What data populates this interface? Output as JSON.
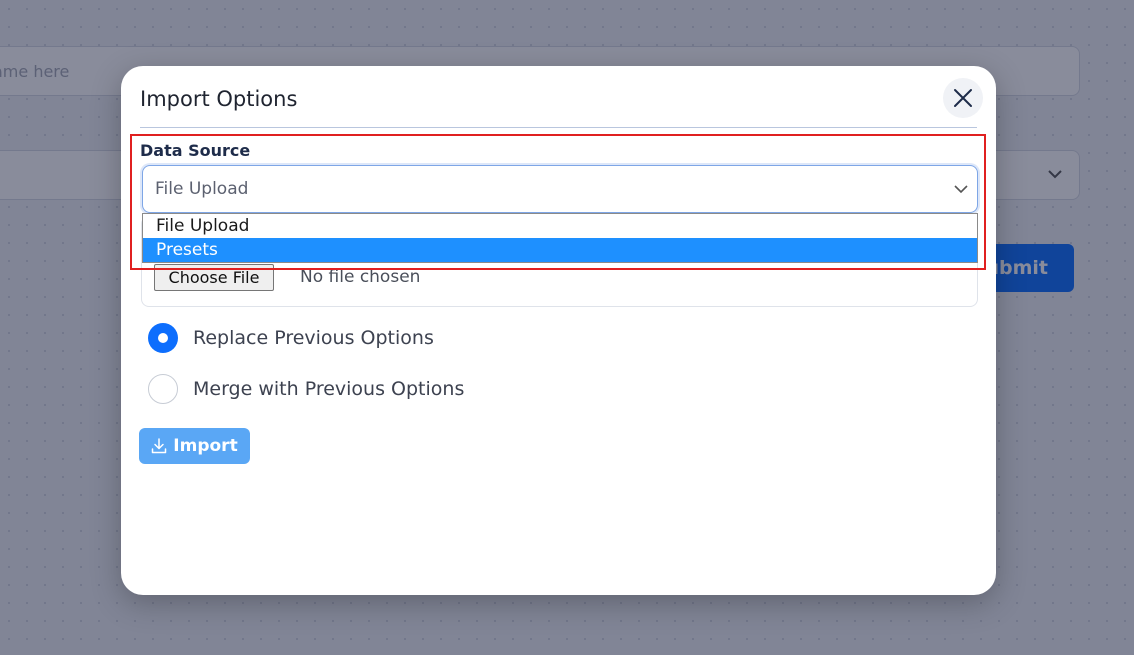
{
  "background": {
    "name_placeholder": "ame here",
    "submit_label": "Submit"
  },
  "modal": {
    "title": "Import Options",
    "data_source": {
      "label": "Data Source",
      "selected": "File Upload",
      "options": [
        "File Upload",
        "Presets"
      ],
      "highlighted_option": "Presets"
    },
    "file_input": {
      "button_label": "Choose File",
      "status": "No file chosen"
    },
    "radio_options": [
      {
        "label": "Replace Previous Options",
        "checked": true
      },
      {
        "label": "Merge with Previous Options",
        "checked": false
      }
    ],
    "import_label": "Import"
  },
  "colors": {
    "accent": "#0d6efd",
    "import_button": "#5aa7f5",
    "highlight_border": "#e02020",
    "dropdown_selected": "#1e90ff"
  },
  "icons": [
    "close-icon",
    "chevron-down-icon",
    "download-icon"
  ]
}
